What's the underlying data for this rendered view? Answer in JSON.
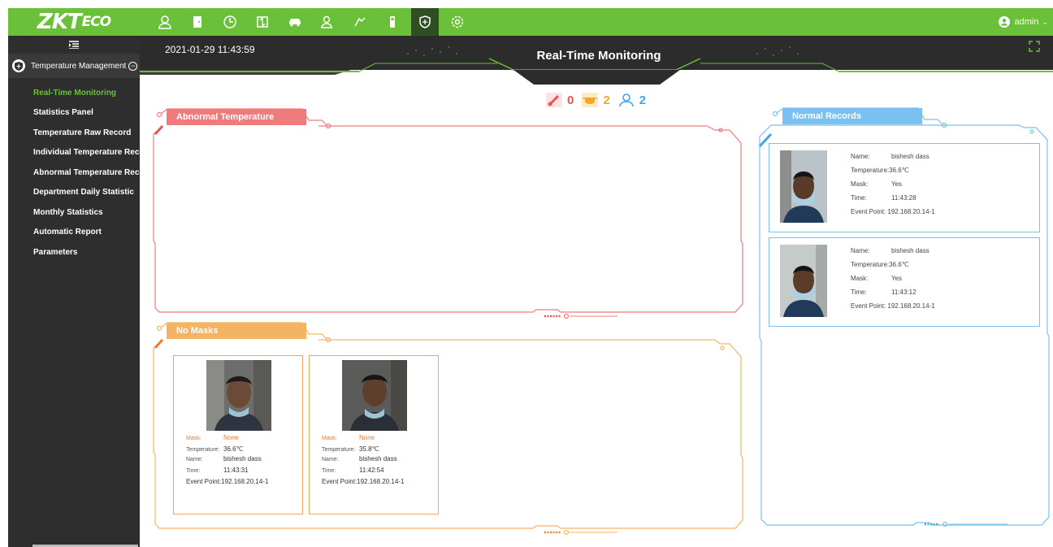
{
  "brand": {
    "logo_main": "ZKT",
    "logo_sub": "ECO"
  },
  "topnav": {
    "items": [
      {
        "name": "personnel-icon",
        "active": false
      },
      {
        "name": "access-door-icon",
        "active": false
      },
      {
        "name": "attendance-clock-icon",
        "active": false
      },
      {
        "name": "elevator-icon",
        "active": false
      },
      {
        "name": "parking-car-icon",
        "active": false
      },
      {
        "name": "visitor-icon",
        "active": false
      },
      {
        "name": "patrol-icon",
        "active": false
      },
      {
        "name": "device-icon",
        "active": false
      },
      {
        "name": "temperature-shield-icon",
        "active": true
      },
      {
        "name": "system-settings-icon",
        "active": false
      }
    ]
  },
  "user": {
    "name": "admin"
  },
  "sidebar": {
    "group_label": "Temperature Management",
    "items": [
      {
        "label": "Real-Time Monitoring",
        "active": true
      },
      {
        "label": "Statistics Panel",
        "active": false
      },
      {
        "label": "Temperature Raw Record",
        "active": false
      },
      {
        "label": "Individual Temperature Record",
        "active": false
      },
      {
        "label": "Abnormal Temperature Record",
        "active": false
      },
      {
        "label": "Department Daily Statistic",
        "active": false
      },
      {
        "label": "Monthly Statistics",
        "active": false
      },
      {
        "label": "Automatic Report",
        "active": false
      },
      {
        "label": "Parameters",
        "active": false
      }
    ]
  },
  "header": {
    "datetime": "2021-01-29 11:43:59",
    "title": "Real-Time Monitoring"
  },
  "counters": {
    "abnormal": {
      "value": "0",
      "color": "#f05050",
      "icon": "thermometer-icon"
    },
    "no_mask": {
      "value": "2",
      "color": "#f5a623",
      "icon": "mask-icon"
    },
    "normal": {
      "value": "2",
      "color": "#3ea6e8",
      "icon": "person-icon"
    }
  },
  "panels": {
    "abnormal": {
      "title": "Abnormal Temperature",
      "color": "#f07b7b"
    },
    "no_masks": {
      "title": "No Masks",
      "color": "#f5b463"
    },
    "normal": {
      "title": "Normal Records",
      "color": "#79c1f0"
    }
  },
  "labels": {
    "mask": "Mask:",
    "temperature": "Temperature:",
    "name": "Name:",
    "time": "Time:",
    "event_point": "Event Point:"
  },
  "no_mask_records": [
    {
      "mask": "None",
      "temperature": "36.6℃",
      "name": "bishesh dass",
      "time": "11:43:31",
      "event_point": "192.168.20.14-1"
    },
    {
      "mask": "None",
      "temperature": "35.8℃",
      "name": "bishesh dass",
      "time": "11:42:54",
      "event_point": "192.168.20.14-1"
    }
  ],
  "normal_records": [
    {
      "name": "bishesh dass",
      "temperature": "36.6℃",
      "mask": "Yes",
      "time": "11:43:28",
      "event_point": "192.168.20.14-1"
    },
    {
      "name": "bishesh dass",
      "temperature": "36.6℃",
      "mask": "Yes",
      "time": "11:43:12",
      "event_point": "192.168.20.14-1"
    }
  ]
}
